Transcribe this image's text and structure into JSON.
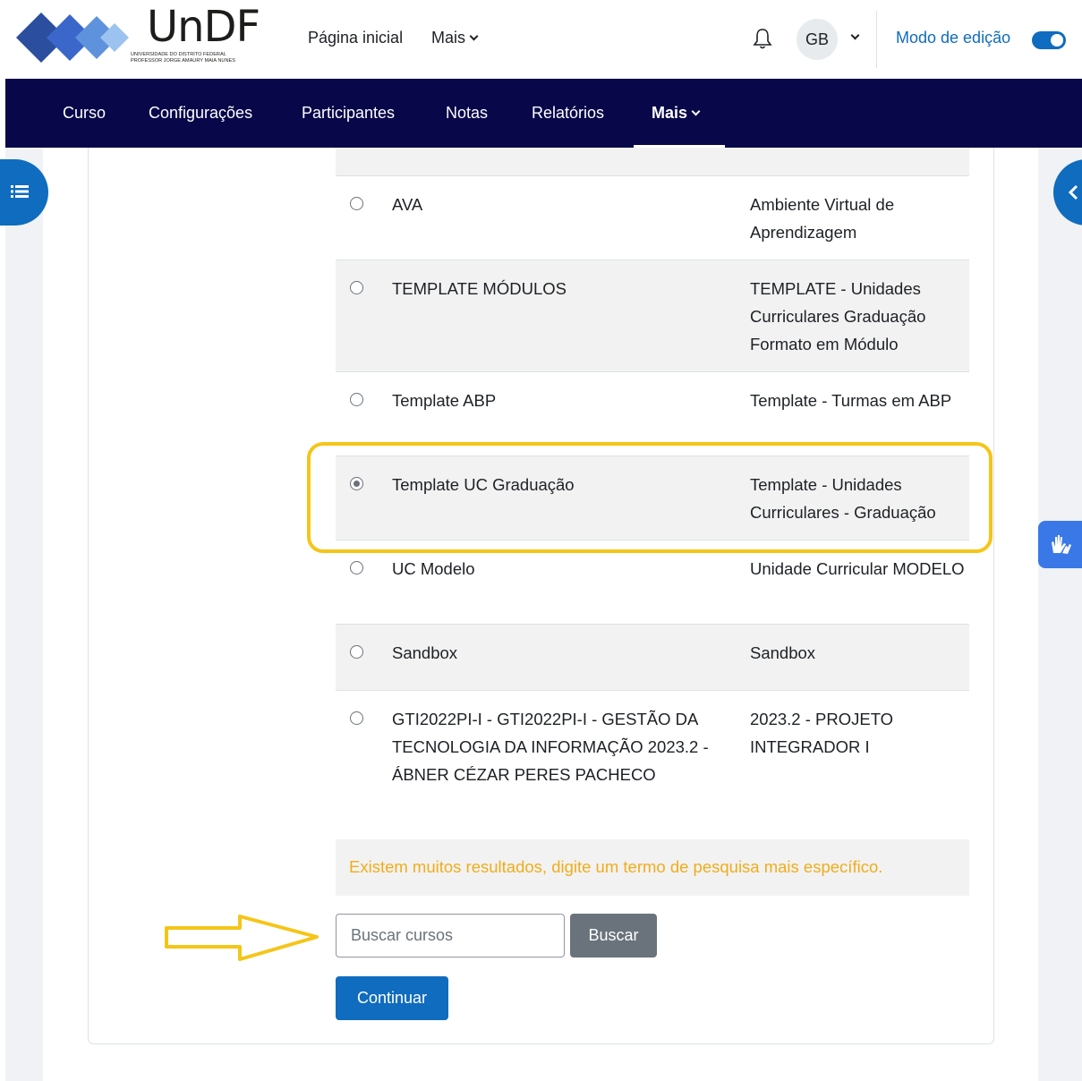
{
  "brand": {
    "logo_text": "UnDF",
    "logo_line1": "UNIVERSIDADE DO DISTRITO FEDERAL",
    "logo_line2": "PROFESSOR JORGE AMAURY MAIA NUNES"
  },
  "topnav": {
    "home": "Página inicial",
    "more": "Mais",
    "avatar_initials": "GB",
    "edit_mode_label": "Modo de edição",
    "edit_mode_on": true
  },
  "course_nav": {
    "items": [
      "Curso",
      "Configurações",
      "Participantes",
      "Notas",
      "Relatórios",
      "Mais"
    ],
    "active": "Mais"
  },
  "courses": [
    {
      "name": "AVA",
      "description": "Ambiente Virtual de Aprendizagem",
      "selected": false
    },
    {
      "name": "TEMPLATE MÓDULOS",
      "description": "TEMPLATE - Unidades Curriculares Graduação Formato em Módulo",
      "selected": false
    },
    {
      "name": "Template ABP",
      "description": "Template - Turmas em ABP",
      "selected": false
    },
    {
      "name": "Template UC Graduação",
      "description": "Template - Unidades Curriculares - Graduação",
      "selected": true
    },
    {
      "name": "UC Modelo",
      "description": "Unidade Curricular MODELO",
      "selected": false
    },
    {
      "name": "Sandbox",
      "description": "Sandbox",
      "selected": false
    },
    {
      "name": "GTI2022PI-I - GTI2022PI-I - GESTÃO DA TECNOLOGIA DA INFORMAÇÃO 2023.2 - ÁBNER CÉZAR PERES PACHECO",
      "description": "2023.2 - PROJETO INTEGRADOR I",
      "selected": false
    }
  ],
  "warning": "Existem muitos resultados, digite um termo de pesquisa mais específico.",
  "search": {
    "placeholder": "Buscar cursos",
    "button": "Buscar"
  },
  "continue_button": "Continuar",
  "colors": {
    "primary": "#0f6cbf",
    "navbar": "#07074a",
    "highlight": "#f5c518",
    "warning_text": "#f0ad1a"
  }
}
